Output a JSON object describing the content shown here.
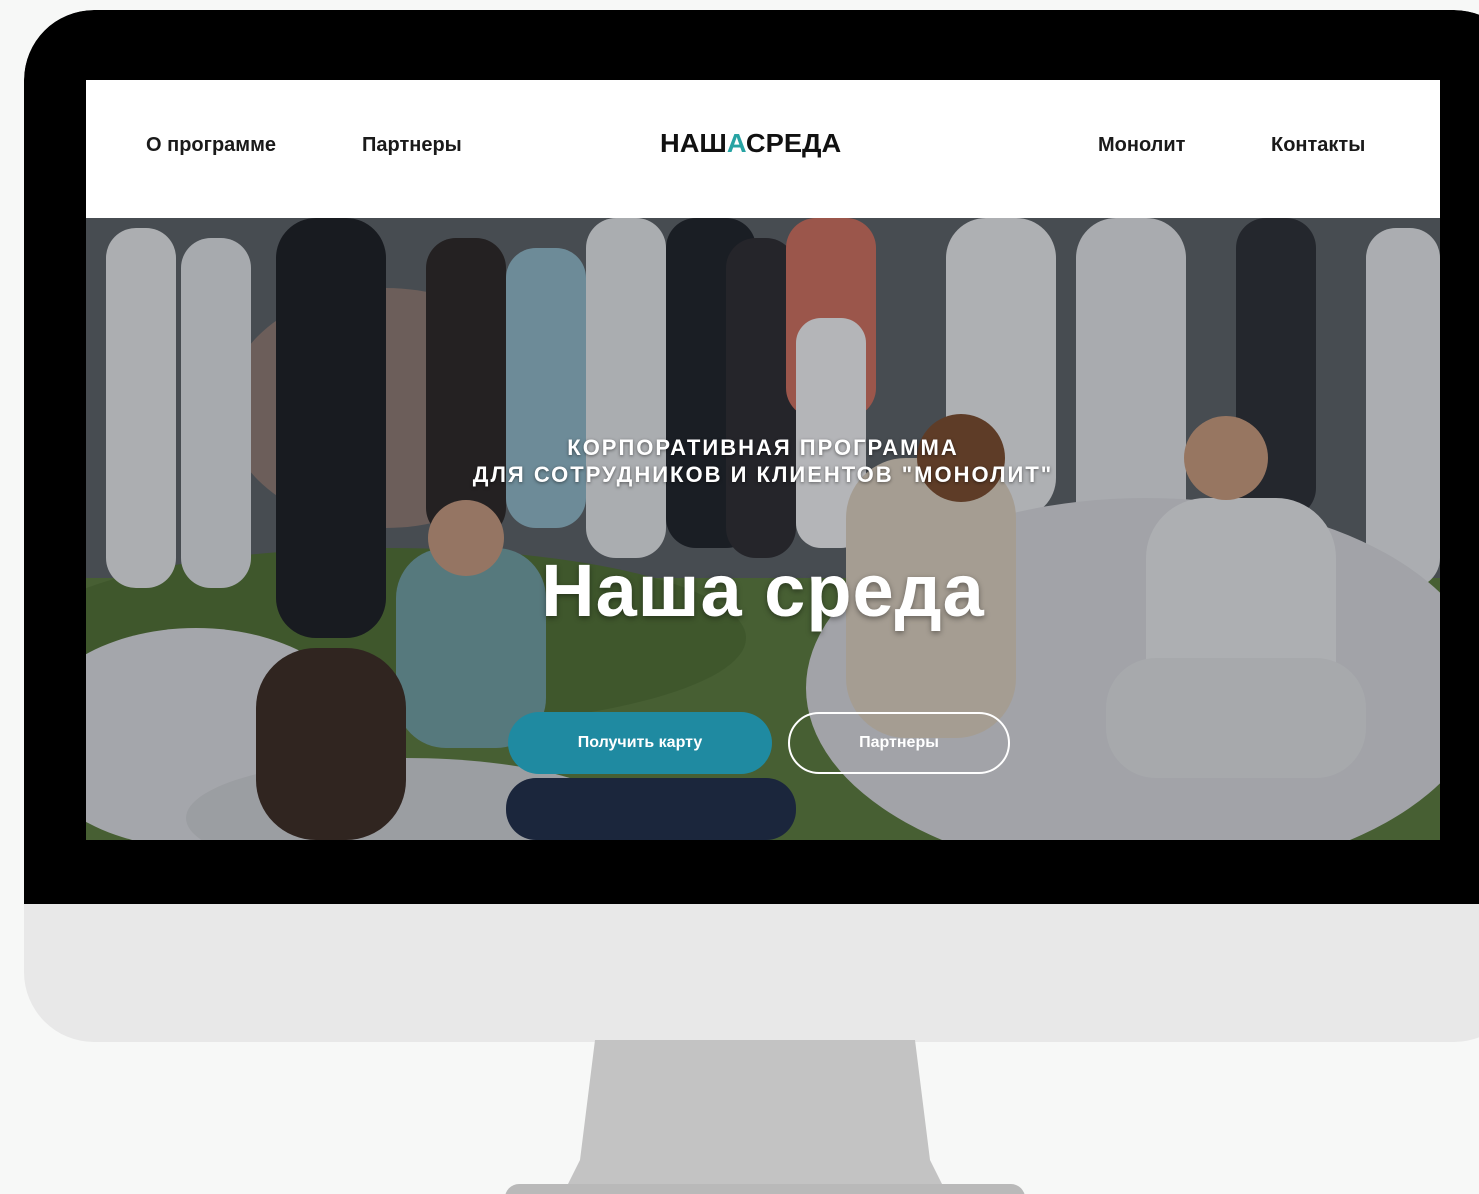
{
  "nav": {
    "left": [
      "О программе",
      "Партнеры"
    ],
    "right": [
      "Монолит",
      "Контакты"
    ]
  },
  "logo": {
    "part1": "НАШ",
    "accent": "А",
    "part2": "СРЕДА"
  },
  "hero": {
    "subtitle_line1": "КОРПОРАТИВНАЯ ПРОГРАММА",
    "subtitle_line2": "ДЛЯ СОТРУДНИКОВ И КЛИЕНТОВ \"МОНОЛИТ\"",
    "title": "Наша среда",
    "primary_button": "Получить карту",
    "secondary_button": "Партнеры"
  },
  "colors": {
    "accent": "#1f8aa1",
    "logo_accent": "#27a3a3",
    "bezel": "#000000",
    "monitor_body": "#e8e8e8"
  }
}
